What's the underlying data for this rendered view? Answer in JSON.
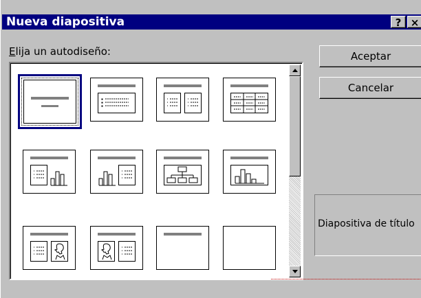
{
  "dialog": {
    "title": "Nueva diapositiva",
    "help_button": "?",
    "close_button": "×",
    "prompt_accesskey": "E",
    "prompt_rest": "lija un autodiseño:",
    "ok_label": "Aceptar",
    "cancel_label": "Cancelar",
    "preview_label": "Diapositiva de título"
  },
  "layouts": [
    {
      "name": "title-slide",
      "selected": true
    },
    {
      "name": "bulleted-list"
    },
    {
      "name": "two-column-text"
    },
    {
      "name": "table"
    },
    {
      "name": "text-and-chart"
    },
    {
      "name": "chart-and-text"
    },
    {
      "name": "organization-chart"
    },
    {
      "name": "chart"
    },
    {
      "name": "text-and-clip-art"
    },
    {
      "name": "clip-art-and-text"
    },
    {
      "name": "title-only"
    },
    {
      "name": "blank"
    }
  ],
  "colors": {
    "titlebar": "#000080",
    "face": "#c0c0c0"
  }
}
